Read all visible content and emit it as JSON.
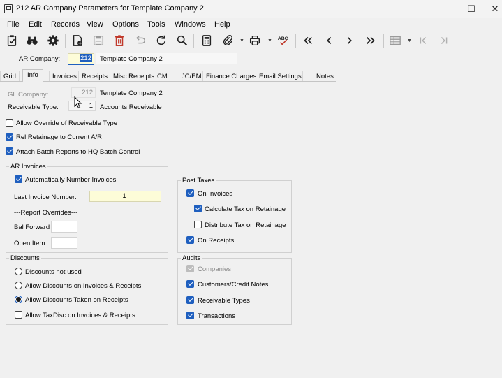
{
  "window": {
    "title": "212 AR Company Parameters for Template Company 2",
    "minimize_glyph": "—",
    "maximize_glyph": "☐",
    "close_glyph": "✕"
  },
  "menu": [
    "File",
    "Edit",
    "Records",
    "View",
    "Options",
    "Tools",
    "Windows",
    "Help"
  ],
  "toolbar": {
    "icons": [
      "clipboard-check-icon",
      "binoculars-icon",
      "gear-icon",
      "new-record-icon",
      "save-icon",
      "delete-icon",
      "undo-icon",
      "refresh-icon",
      "search-icon",
      "calculator-icon",
      "attach-icon",
      "print-icon",
      "spellcheck-icon",
      "first-record-icon",
      "previous-record-icon",
      "next-record-icon",
      "last-record-icon",
      "grid-view-icon",
      "first-page-icon",
      "last-page-icon"
    ],
    "spellcheck_text": "ABC",
    "accent_color": "#1f5fbf",
    "delete_color": "#c0392b"
  },
  "header": {
    "ar_company_label": "AR Company:",
    "ar_company_value": "212",
    "ar_company_name": "Template Company 2"
  },
  "tabs": [
    "Grid",
    "Info",
    "Invoices",
    "Receipts",
    "Misc Receipts",
    "CM",
    "JC/EM",
    "Finance Charges",
    "Email Settings",
    "Notes"
  ],
  "active_tab": "Info",
  "info": {
    "gl_company_label": "GL Company:",
    "gl_company_value": "212",
    "gl_company_name": "Template Company 2",
    "receivable_type_label": "Receivable Type:",
    "receivable_type_value": "1",
    "receivable_type_name": "Accounts Receivable",
    "allow_override_label": "Allow Override of Receivable Type",
    "allow_override_checked": false,
    "rel_retainage_label": "Rel Retainage to Current A/R",
    "rel_retainage_checked": true,
    "attach_batch_label": "Attach Batch Reports to HQ Batch Control",
    "attach_batch_checked": true
  },
  "ar_invoices": {
    "title": "AR Invoices",
    "auto_number_label": "Automatically Number Invoices",
    "auto_number_checked": true,
    "last_invoice_label": "Last Invoice Number:",
    "last_invoice_value": "1",
    "report_overrides_label": "---Report Overrides---",
    "bal_forward_label": "Bal Forward",
    "bal_forward_value": "",
    "open_item_label": "Open Item",
    "open_item_value": ""
  },
  "discounts": {
    "title": "Discounts",
    "options": [
      {
        "label": "Discounts not used",
        "selected": false
      },
      {
        "label": "Allow Discounts on Invoices & Receipts",
        "selected": false
      },
      {
        "label": "Allow Discounts Taken on Receipts",
        "selected": true
      }
    ],
    "taxdisc_label": "Allow TaxDisc on Invoices & Receipts",
    "taxdisc_checked": false
  },
  "post_taxes": {
    "title": "Post Taxes",
    "on_invoices_label": "On Invoices",
    "on_invoices_checked": true,
    "calc_tax_label": "Calculate Tax on Retainage",
    "calc_tax_checked": true,
    "distribute_tax_label": "Distribute Tax on Retainage",
    "distribute_tax_checked": false,
    "on_receipts_label": "On Receipts",
    "on_receipts_checked": true
  },
  "audits": {
    "title": "Audits",
    "companies_label": "Companies",
    "companies_checked": true,
    "customers_label": "Customers/Credit Notes",
    "customers_checked": true,
    "receivable_types_label": "Receivable Types",
    "receivable_types_checked": true,
    "transactions_label": "Transactions",
    "transactions_checked": true
  }
}
